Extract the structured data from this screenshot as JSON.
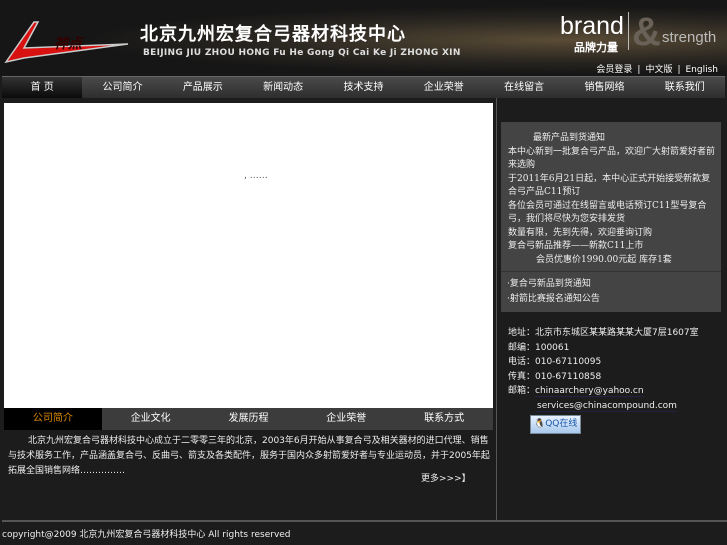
{
  "header": {
    "title_cn": "北京九州宏复合弓器材科技中心",
    "title_en": "BEIJING JIU ZHOU HONG Fu He Gong Qi Cai Ke Ji ZHONG XIN",
    "logo_text": "神点",
    "brand": "brand",
    "brand_cn": "品牌力量",
    "amp": "&",
    "strength": "strength",
    "links": [
      "会员登录",
      "中文版",
      "English"
    ]
  },
  "nav": [
    "首 页",
    "公司简介",
    "产品展示",
    "新闻动态",
    "技术支持",
    "企业荣誉",
    "在线留言",
    "销售网络",
    "联系我们"
  ],
  "main": {
    "dots": ", ……"
  },
  "tabs": [
    "公司简介",
    "企业文化",
    "发展历程",
    "企业荣誉",
    "联系方式"
  ],
  "intro": "北京九州宏复合弓器材科技中心成立于二零零三年的北京，2003年6月开始从事复合弓及相关器材的进口代理、销售与技术服务工作，产品涵盖复合弓、反曲弓、箭支及各类配件，服务于国内众多射箭爱好者与专业运动员，并于2005年起拓展全国销售网络……………",
  "more": "更多>>>】",
  "news": {
    "heading": "最新产品到货通知",
    "lines": [
      "本中心新到一批复合弓产品，欢迎广大射箭爱好者前来选购",
      "于2011年6月21日起，本中心正式开始接受新款复合弓产品C11预订",
      "各位会员可通过在线留言或电话预订C11型号复合弓，我们将尽快为您安排发货",
      "数量有限，先到先得，欢迎垂询订购",
      "复合弓新品推荐——新款C11上市",
      "  会员优惠价1990.00元起   库存1套"
    ],
    "list": [
      "·复合弓新品到货通知",
      "·射箭比赛报名通知公告"
    ]
  },
  "contact": {
    "address": "地址：北京市东城区某某路某某大厦7层1607室",
    "postcode": "邮编：100061",
    "phone": "电话：010-67110095",
    "fax": "传真：010-67110858",
    "email_label": "邮箱：",
    "email1": "chinaarchery@yahoo.cn",
    "email2": "services@chinacompound.com",
    "qq": "QQ在线"
  },
  "footer": "copyright@2009 北京九州宏复合弓器材科技中心 All rights reserved",
  "colors": {
    "active_tab": "#e08a00",
    "logo_red": "#d81010"
  }
}
